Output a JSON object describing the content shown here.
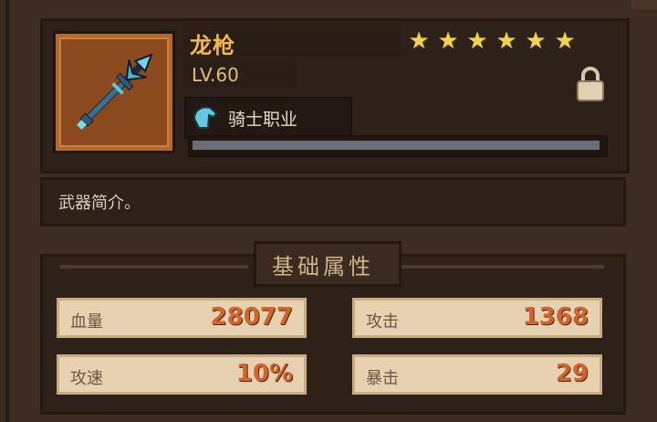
{
  "weapon": {
    "name": "龙枪",
    "level": "LV.60",
    "stars": [
      "★",
      "★",
      "★",
      "★",
      "★",
      "★"
    ],
    "job": "骑士职业",
    "description": "武器简介。",
    "xp_fraction": 0.99
  },
  "icons": {
    "weapon": "dragon-spear-icon",
    "lock": "lock-icon",
    "job": "knight-helmet-icon",
    "star": "star-icon"
  },
  "attributes": {
    "title": "基础属性",
    "stats": [
      {
        "label": "血量",
        "value": "28077"
      },
      {
        "label": "攻击",
        "value": "1368"
      },
      {
        "label": "攻速",
        "value": "10%"
      },
      {
        "label": "暴击",
        "value": "29"
      }
    ]
  },
  "colors": {
    "name": "#f2b84a",
    "stat_value": "#d0652d",
    "star": "#f4d24c"
  }
}
